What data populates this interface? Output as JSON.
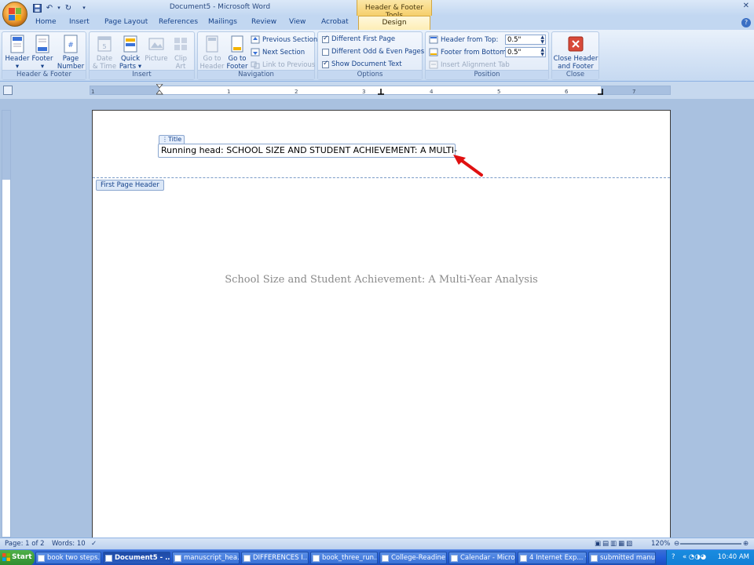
{
  "window": {
    "title": "Document5 - Microsoft Word",
    "contextual_tools_title": "Header & Footer Tools"
  },
  "tabs": [
    "Home",
    "Insert",
    "Page Layout",
    "References",
    "Mailings",
    "Review",
    "View",
    "Acrobat",
    "Design"
  ],
  "active_tab": "Design",
  "ribbon": {
    "header_footer": {
      "label": "Header & Footer",
      "header": "Header",
      "footer": "Footer",
      "page_number_1": "Page",
      "page_number_2": "Number"
    },
    "insert": {
      "label": "Insert",
      "date_time_1": "Date",
      "date_time_2": "& Time",
      "quick_parts_1": "Quick",
      "quick_parts_2": "Parts",
      "picture": "Picture",
      "clip_art_1": "Clip",
      "clip_art_2": "Art"
    },
    "navigation": {
      "label": "Navigation",
      "go_to_header_1": "Go to",
      "go_to_header_2": "Header",
      "go_to_footer_1": "Go to",
      "go_to_footer_2": "Footer",
      "previous_section": "Previous Section",
      "next_section": "Next Section",
      "link_to_previous": "Link to Previous"
    },
    "options": {
      "label": "Options",
      "different_first_page": "Different First Page",
      "different_first_page_checked": true,
      "different_odd_even": "Different Odd & Even Pages",
      "different_odd_even_checked": false,
      "show_document_text": "Show Document Text",
      "show_document_text_checked": true
    },
    "position": {
      "label": "Position",
      "header_from_top": "Header from Top:",
      "header_from_top_value": "0.5\"",
      "footer_from_bottom": "Footer from Bottom:",
      "footer_from_bottom_value": "0.5\"",
      "insert_alignment_tab": "Insert Alignment Tab"
    },
    "close": {
      "label": "Close",
      "close_header_1": "Close Header",
      "close_header_2": "and Footer"
    }
  },
  "ruler_numbers": [
    "1",
    "1",
    "2",
    "3",
    "4",
    "5",
    "6",
    "7"
  ],
  "document": {
    "title_control_tag": "Title",
    "header_text": "Running head: SCHOOL SIZE AND STUDENT ACHIEVEMENT: A MULTI-",
    "first_page_header_tag": "First Page Header",
    "body_title": "School Size and Student Achievement: A Multi-Year Analysis"
  },
  "status_bar": {
    "page": "Page: 1 of 2",
    "words": "Words: 10",
    "zoom": "120%"
  },
  "taskbar": {
    "start": "Start",
    "tasks": [
      "book two steps...",
      "Document5 - ...",
      "manuscript_hea...",
      "DIFFERENCES I...",
      "book_three_run...",
      "College-Readine...",
      "Calendar - Micro...",
      "4 Internet Exp...",
      "submitted manu..."
    ],
    "clock": "10:40 AM"
  },
  "colors": {
    "ribbon_text": "#15428b",
    "contextual_tab": "#f6cf6b",
    "annotation_arrow": "#e01010",
    "body_title_text": "#8a8a8a"
  }
}
